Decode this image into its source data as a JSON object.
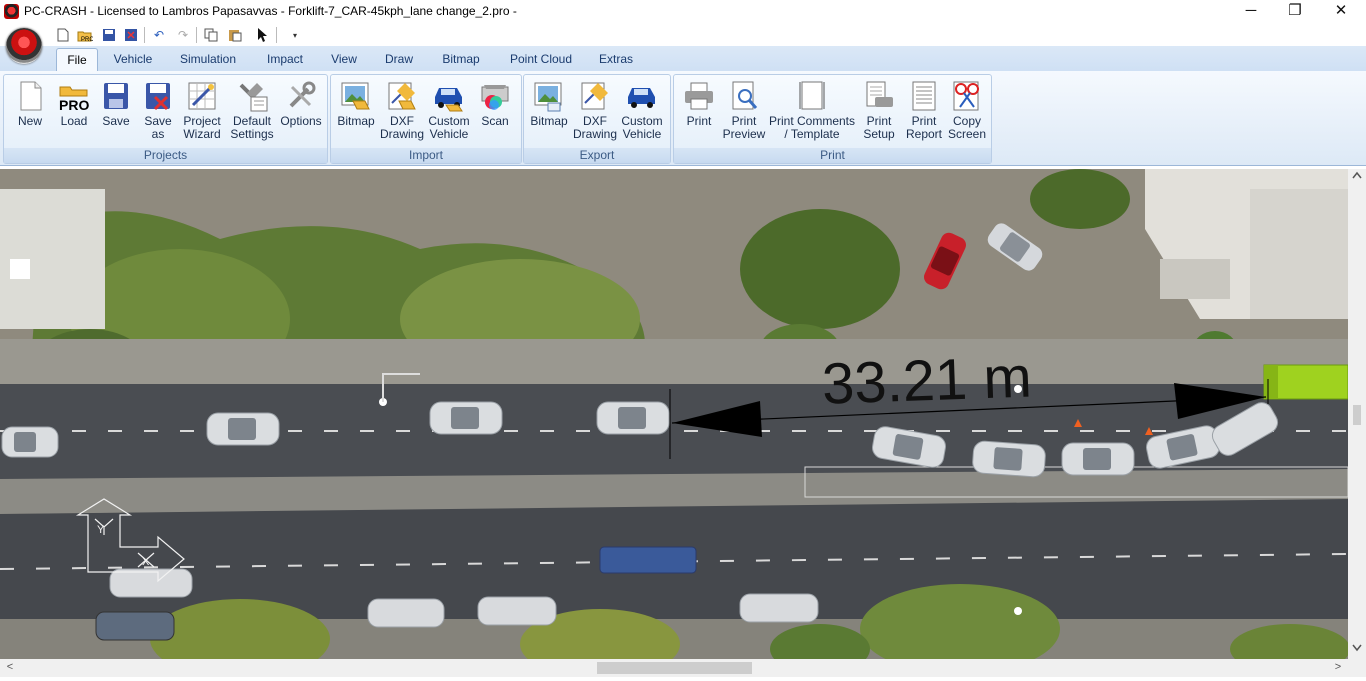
{
  "window": {
    "title": "PC-CRASH - Licensed to Lambros Papasavvas - Forklift-7_CAR-45kph_lane change_2.pro -",
    "controls": {
      "minimize": "─",
      "restore": "❐",
      "close": "✕"
    }
  },
  "quick_access": {
    "icons": [
      "new-file-icon",
      "open-pro-icon",
      "save-icon",
      "save-as-icon",
      "undo-icon",
      "redo-icon",
      "copy-icon",
      "paste-icon",
      "pointer-icon",
      "dropdown-icon"
    ]
  },
  "tabs": [
    {
      "label": "File",
      "active": true
    },
    {
      "label": "Vehicle"
    },
    {
      "label": "Simulation"
    },
    {
      "label": "Impact"
    },
    {
      "label": "View"
    },
    {
      "label": "Draw"
    },
    {
      "label": "Bitmap"
    },
    {
      "label": "Point Cloud"
    },
    {
      "label": "Extras"
    }
  ],
  "ribbon": {
    "groups": [
      {
        "label": "Projects",
        "buttons": [
          {
            "label": "New",
            "icon": "new-document-icon"
          },
          {
            "label": "Load",
            "icon": "load-pro-icon",
            "icon_text": "PRO"
          },
          {
            "label": "Save",
            "icon": "floppy-disk-icon"
          },
          {
            "label": "Save as",
            "line1": "Save",
            "line2": "as",
            "icon": "save-as-icon"
          },
          {
            "label": "Project Wizard",
            "line1": "Project",
            "line2": "Wizard",
            "icon": "wizard-icon"
          },
          {
            "label": "Default Settings",
            "line1": "Default",
            "line2": "Settings",
            "icon": "default-settings-icon"
          },
          {
            "label": "Options",
            "icon": "options-tools-icon"
          }
        ]
      },
      {
        "label": "Import",
        "buttons": [
          {
            "label": "Bitmap",
            "icon": "import-bitmap-icon"
          },
          {
            "label": "DXF Drawing",
            "line1": "DXF",
            "line2": "Drawing",
            "icon": "import-dxf-icon"
          },
          {
            "label": "Custom Vehicle",
            "line1": "Custom",
            "line2": "Vehicle",
            "icon": "import-vehicle-icon"
          },
          {
            "label": "Scan",
            "icon": "scan-icon"
          }
        ]
      },
      {
        "label": "Export",
        "buttons": [
          {
            "label": "Bitmap",
            "icon": "export-bitmap-icon"
          },
          {
            "label": "DXF Drawing",
            "line1": "DXF",
            "line2": "Drawing",
            "icon": "export-dxf-icon"
          },
          {
            "label": "Custom Vehicle",
            "line1": "Custom",
            "line2": "Vehicle",
            "icon": "export-vehicle-icon"
          }
        ]
      },
      {
        "label": "Print",
        "buttons": [
          {
            "label": "Print",
            "icon": "printer-icon"
          },
          {
            "label": "Print Preview",
            "line1": "Print",
            "line2": "Preview",
            "icon": "print-preview-icon"
          },
          {
            "label": "Print Comments / Template",
            "line1": "Print Comments",
            "line2": "/ Template",
            "icon": "print-comments-icon"
          },
          {
            "label": "Print Setup",
            "line1": "Print",
            "line2": "Setup",
            "icon": "print-setup-icon"
          },
          {
            "label": "Print Report",
            "line1": "Print",
            "line2": "Report",
            "icon": "print-report-icon"
          },
          {
            "label": "Copy Screen",
            "line1": "Copy",
            "line2": "Screen",
            "icon": "copy-screen-icon"
          }
        ]
      }
    ]
  },
  "scene": {
    "measurement": {
      "text": "33.21 m"
    },
    "coordinate_axes": {
      "y_label": "Y",
      "x_label": "X"
    },
    "colors": {
      "asphalt": "#4a4d52",
      "forklift": "#9fd21f",
      "red_car": "#c8202a",
      "grass": "#6f8a3c"
    }
  },
  "scrollbars": {
    "left_arrow": "<",
    "right_arrow": ">",
    "up_arrow": "^",
    "down_arrow": "v"
  }
}
